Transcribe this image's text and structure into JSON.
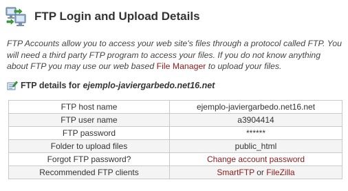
{
  "header": {
    "title": "FTP Login and Upload Details",
    "icon": "ftp-computers-icon"
  },
  "intro": {
    "text_before": "FTP Accounts allow you to access your web site's files through a protocol called FTP. You will need a third party FTP program to access your files. If you do not know anything about FTP you may use our web based",
    "link_label": "File Manager",
    "text_after": "to upload your files."
  },
  "details": {
    "heading_prefix": "FTP details for",
    "domain": "ejemplo-javiergarbedo.net16.net",
    "icon": "edit-note-icon"
  },
  "table": {
    "rows": [
      {
        "label": "FTP host name",
        "value": "ejemplo-javiergarbedo.net16.net"
      },
      {
        "label": "FTP user name",
        "value": "a3904414"
      },
      {
        "label": "FTP password",
        "value": "******"
      },
      {
        "label": "Folder to upload files",
        "value": "public_html"
      },
      {
        "label": "Forgot FTP password?",
        "value": "Change account password"
      },
      {
        "label": "Recommended FTP clients",
        "link1": "SmartFTP",
        "separator": "or",
        "link2": "FileZilla"
      }
    ]
  },
  "colors": {
    "link": "#8b1a1a",
    "border": "#c8c8c8",
    "row_alt": "#f4f4f4",
    "text": "#333333"
  }
}
